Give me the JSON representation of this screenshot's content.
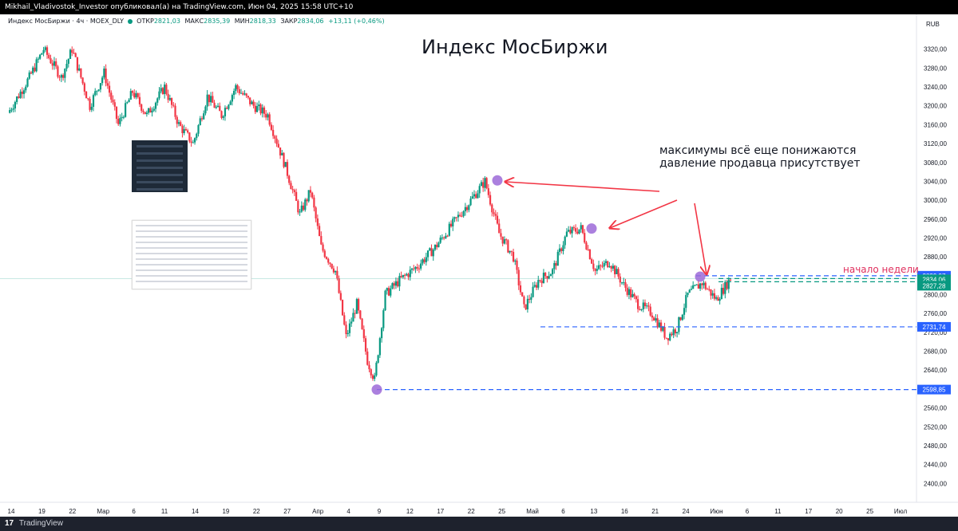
{
  "header": {
    "publisher_line": "Mikhail_Vladivostok_Investor опубликовал(а) на TradingView.com, Июн 04, 2025 15:58 UTC+10"
  },
  "legend": {
    "symbol": "Индекс МосБиржи · 4ч · MOEX_DLY",
    "open_label": "ОТКР",
    "open_value": "2821,03",
    "high_label": "МАКС",
    "high_value": "2835,39",
    "low_label": "МИН",
    "low_value": "2818,33",
    "close_label": "ЗАКР",
    "close_value": "2834,06",
    "change": "+13,11 (+0,46%)",
    "up_color": "#089981"
  },
  "currency": "RUB",
  "footer": {
    "logo": "17",
    "brand": "TradingView"
  },
  "chart_data": {
    "type": "candlestick",
    "title": "Индекс МосБиржи",
    "timeframe": "4h",
    "y_range": [
      2360,
      3360
    ],
    "y_ticks": [
      "3320,00",
      "3280,00",
      "3240,00",
      "3200,00",
      "3160,00",
      "3120,00",
      "3080,00",
      "3040,00",
      "3000,00",
      "2960,00",
      "2920,00",
      "2880,00",
      "2840,00",
      "2800,00",
      "2760,00",
      "2720,00",
      "2680,00",
      "2640,00",
      "2600,00",
      "2560,00",
      "2520,00",
      "2480,00",
      "2440,00",
      "2400,00"
    ],
    "x_ticks": [
      "14",
      "19",
      "22",
      "Мар",
      "6",
      "11",
      "14",
      "19",
      "22",
      "27",
      "Апр",
      "4",
      "9",
      "12",
      "17",
      "22",
      "25",
      "Май",
      "6",
      "13",
      "16",
      "21",
      "24",
      "Июн",
      "6",
      "11",
      "17",
      "20",
      "25",
      "Июл"
    ],
    "price_anchors": [
      {
        "t": 0,
        "price": 3185
      },
      {
        "t": 12,
        "price": 3260
      },
      {
        "t": 20,
        "price": 3320
      },
      {
        "t": 30,
        "price": 3260
      },
      {
        "t": 36,
        "price": 3320
      },
      {
        "t": 46,
        "price": 3200
      },
      {
        "t": 54,
        "price": 3270
      },
      {
        "t": 62,
        "price": 3160
      },
      {
        "t": 70,
        "price": 3230
      },
      {
        "t": 78,
        "price": 3180
      },
      {
        "t": 88,
        "price": 3240
      },
      {
        "t": 96,
        "price": 3160
      },
      {
        "t": 104,
        "price": 3120
      },
      {
        "t": 112,
        "price": 3220
      },
      {
        "t": 120,
        "price": 3180
      },
      {
        "t": 128,
        "price": 3240
      },
      {
        "t": 138,
        "price": 3200
      },
      {
        "t": 146,
        "price": 3180
      },
      {
        "t": 156,
        "price": 3070
      },
      {
        "t": 164,
        "price": 2970
      },
      {
        "t": 170,
        "price": 3020
      },
      {
        "t": 176,
        "price": 2900
      },
      {
        "t": 184,
        "price": 2850
      },
      {
        "t": 190,
        "price": 2710
      },
      {
        "t": 196,
        "price": 2780
      },
      {
        "t": 202,
        "price": 2660
      },
      {
        "t": 206,
        "price": 2620
      },
      {
        "t": 212,
        "price": 2800
      },
      {
        "t": 220,
        "price": 2830
      },
      {
        "t": 230,
        "price": 2860
      },
      {
        "t": 240,
        "price": 2900
      },
      {
        "t": 252,
        "price": 2960
      },
      {
        "t": 262,
        "price": 3010
      },
      {
        "t": 268,
        "price": 3040
      },
      {
        "t": 276,
        "price": 2930
      },
      {
        "t": 284,
        "price": 2880
      },
      {
        "t": 290,
        "price": 2770
      },
      {
        "t": 298,
        "price": 2830
      },
      {
        "t": 306,
        "price": 2850
      },
      {
        "t": 314,
        "price": 2930
      },
      {
        "t": 322,
        "price": 2940
      },
      {
        "t": 330,
        "price": 2850
      },
      {
        "t": 338,
        "price": 2870
      },
      {
        "t": 346,
        "price": 2820
      },
      {
        "t": 354,
        "price": 2780
      },
      {
        "t": 362,
        "price": 2760
      },
      {
        "t": 370,
        "price": 2710
      },
      {
        "t": 376,
        "price": 2730
      },
      {
        "t": 382,
        "price": 2800
      },
      {
        "t": 390,
        "price": 2825
      },
      {
        "t": 398,
        "price": 2790
      },
      {
        "t": 406,
        "price": 2834
      }
    ],
    "levels": [
      {
        "price": 2839.97,
        "label": "2839,97",
        "color": "#2962ff",
        "style": "dashed"
      },
      {
        "price": 2834.06,
        "label": "2834,06",
        "color": "#089981",
        "style": "dashed"
      },
      {
        "price": 2827.28,
        "label": "2827,28",
        "color": "#089981",
        "style": "dashed"
      },
      {
        "price": 2731.74,
        "label": "2731,74",
        "color": "#2962ff",
        "style": "dashed"
      },
      {
        "price": 2598.85,
        "label": "2598,85",
        "color": "#2962ff",
        "style": "dashed"
      }
    ],
    "annotations": {
      "note_line1": "максимумы всё еще понижаются",
      "note_line2": "давление продавца присутствует",
      "week_start": "начало недели"
    },
    "markers_color": "#9c6ad8",
    "up_color": "#089981",
    "down_color": "#f23645"
  }
}
